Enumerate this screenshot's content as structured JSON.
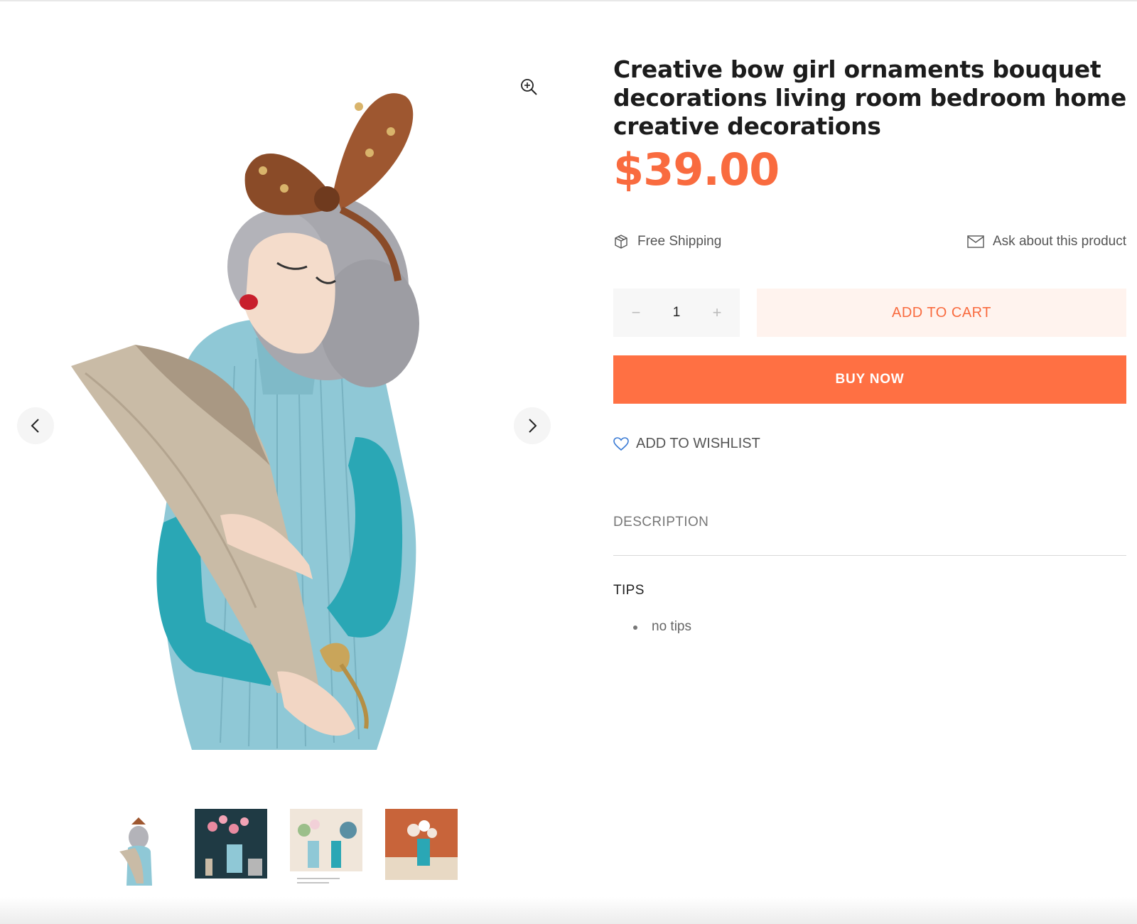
{
  "product": {
    "title": "Creative bow girl ornaments bouquet decorations living room bedroom home creative decorations",
    "price": "$39.00",
    "image_alt": "Girl figurine with brown polka-dot bow holding a paper bouquet vase"
  },
  "features": {
    "shipping_label": "Free Shipping",
    "ask_label": "Ask about this product"
  },
  "cart": {
    "quantity": "1",
    "minus_symbol": "−",
    "plus_symbol": "+",
    "add_to_cart_label": "ADD TO CART",
    "buy_now_label": "BUY NOW"
  },
  "wishlist": {
    "label": "ADD TO WISHLIST"
  },
  "tabs": {
    "description_label": "DESCRIPTION"
  },
  "tips": {
    "heading": "TIPS",
    "items": [
      "no tips"
    ]
  },
  "gallery": {
    "thumbnail_count": 4
  },
  "colors": {
    "accent": "#f96b3f",
    "buy_now_bg": "#ff7043",
    "add_to_cart_bg": "#fff3ee",
    "wishlist_icon": "#3a7bd5"
  },
  "icons": {
    "zoom": "zoom-in-icon",
    "prev": "chevron-left-icon",
    "next": "chevron-right-icon",
    "shipping": "box-icon",
    "ask": "envelope-icon",
    "wishlist": "heart-icon"
  }
}
